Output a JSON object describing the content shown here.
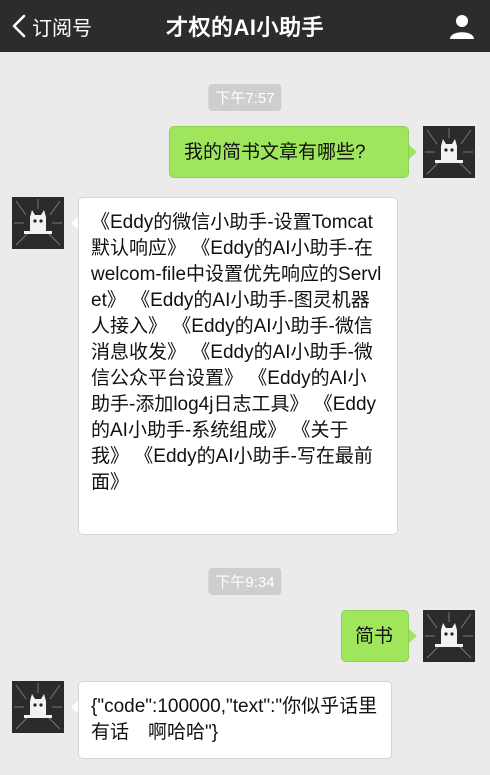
{
  "header": {
    "back_label": "订阅号",
    "title": "才权的AI小助手"
  },
  "chat": {
    "timestamps": [
      "下午7:57",
      "下午9:34"
    ],
    "messages": [
      {
        "side": "out",
        "text": "我的简书文章有哪些?"
      },
      {
        "side": "in",
        "text": "《Eddy的微信小助手-设置Tomcat默认响应》 《Eddy的AI小助手-在welcom-file中设置优先响应的Servlet》 《Eddy的AI小助手-图灵机器人接入》 《Eddy的AI小助手-微信消息收发》 《Eddy的AI小助手-微信公众平台设置》 《Eddy的AI小助手-添加log4j日志工具》 《Eddy的AI小助手-系统组成》 《关于我》 《Eddy的AI小助手-写在最前面》"
      },
      {
        "side": "out",
        "text": "简书"
      },
      {
        "side": "in",
        "text": "{\"code\":100000,\"text\":\"你似乎话里有话　啊哈哈\"}"
      }
    ]
  },
  "colors": {
    "header_bg": "#2c2c2e",
    "chat_bg": "#ebebeb",
    "outgoing_bubble": "#9fe65d",
    "incoming_bubble": "#ffffff",
    "timestamp_bg": "#cecece"
  },
  "icons": [
    "chevron-left-icon",
    "person-icon",
    "cat-avatar"
  ]
}
